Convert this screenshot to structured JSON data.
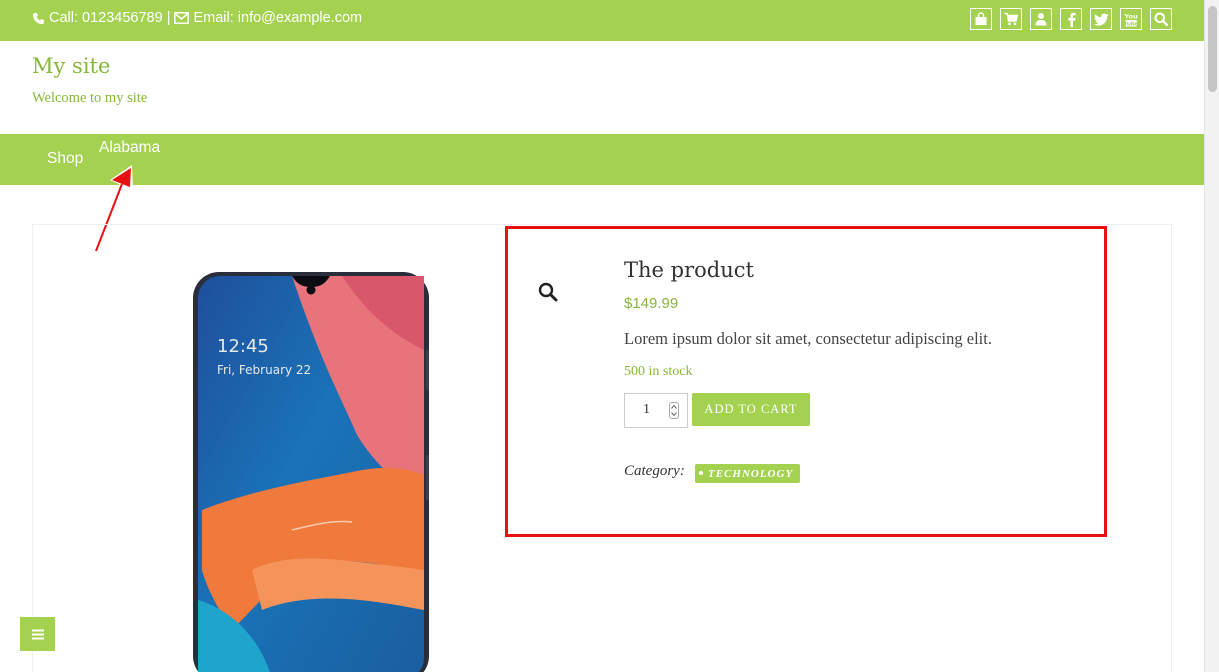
{
  "topbar": {
    "call_label": "Call: 0123456789",
    "separator": "|",
    "email_label": "Email: info@example.com",
    "icons": [
      "bag-icon",
      "cart-icon",
      "user-icon",
      "facebook-icon",
      "twitter-icon",
      "youtube-icon",
      "search-icon"
    ]
  },
  "site": {
    "title": "My site",
    "tagline": "Welcome to my site"
  },
  "nav": {
    "items": [
      {
        "label": "Shop"
      },
      {
        "label": "Alabama"
      }
    ]
  },
  "product": {
    "title": "The product",
    "price": "$149.99",
    "description": "Lorem ipsum dolor sit amet, consectetur adipiscing elit.",
    "stock": "500 in stock",
    "quantity": "1",
    "add_to_cart": "ADD TO CART",
    "category_label": "Category:",
    "category": "TECHNOLOGY",
    "image": {
      "time": "12:45",
      "date": "Fri, February 22"
    }
  },
  "colors": {
    "brand_green": "#a4d14f",
    "text_green": "#86b83a",
    "highlight_red": "#e81010"
  }
}
